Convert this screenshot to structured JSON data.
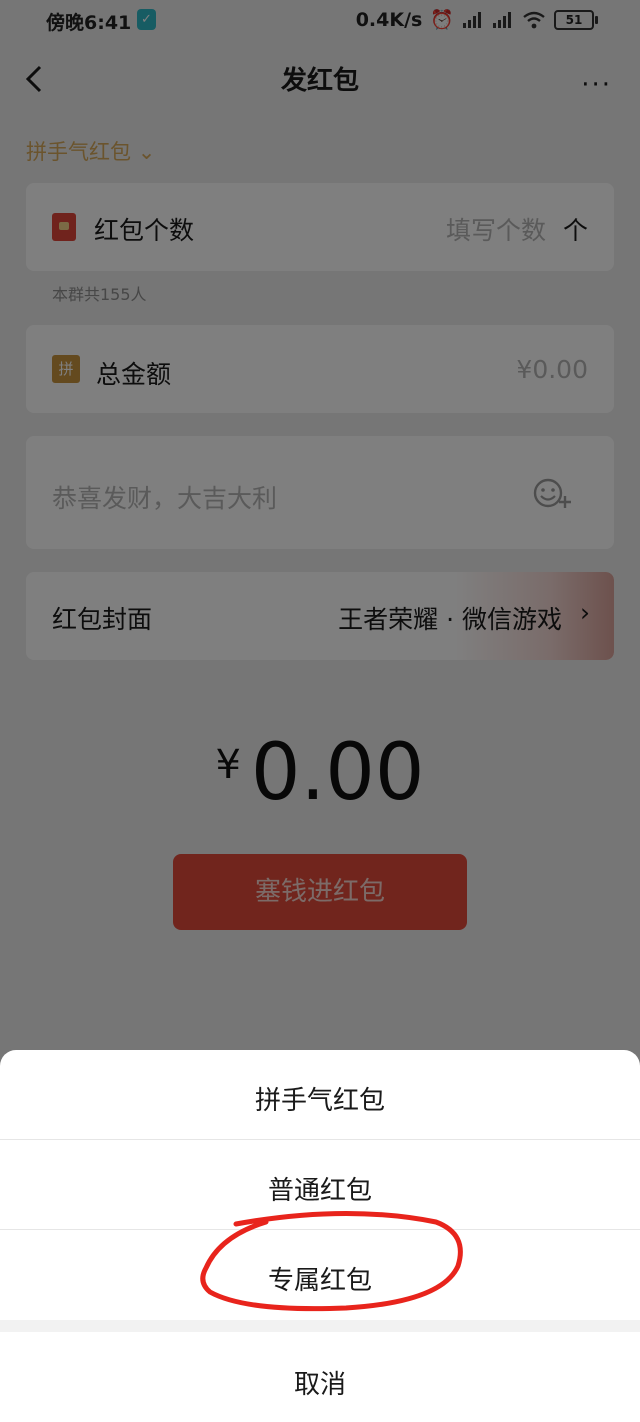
{
  "status_bar": {
    "time": "傍晚6:41",
    "speed": "0.4K/s",
    "battery": "51"
  },
  "nav": {
    "title": "发红包",
    "more": "···"
  },
  "type_selector": {
    "label": "拼手气红包"
  },
  "count_row": {
    "label": "红包个数",
    "placeholder": "填写个数",
    "unit": "个",
    "note": "本群共155人"
  },
  "amount_row": {
    "icon_text": "拼",
    "label": "总金额",
    "placeholder": "¥0.00"
  },
  "message_row": {
    "placeholder": "恭喜发财，大吉大利"
  },
  "cover_row": {
    "label": "红包封面",
    "value": "王者荣耀 · 微信游戏"
  },
  "total": {
    "currency": "¥",
    "value": "0.00"
  },
  "submit_button": {
    "label": "塞钱进红包"
  },
  "action_sheet": {
    "options": [
      "拼手气红包",
      "普通红包",
      "专属红包"
    ],
    "cancel": "取消"
  },
  "colors": {
    "accent_red": "#e24a3b",
    "gold": "#d6a95a",
    "annotation_circle": "#e8241c"
  }
}
